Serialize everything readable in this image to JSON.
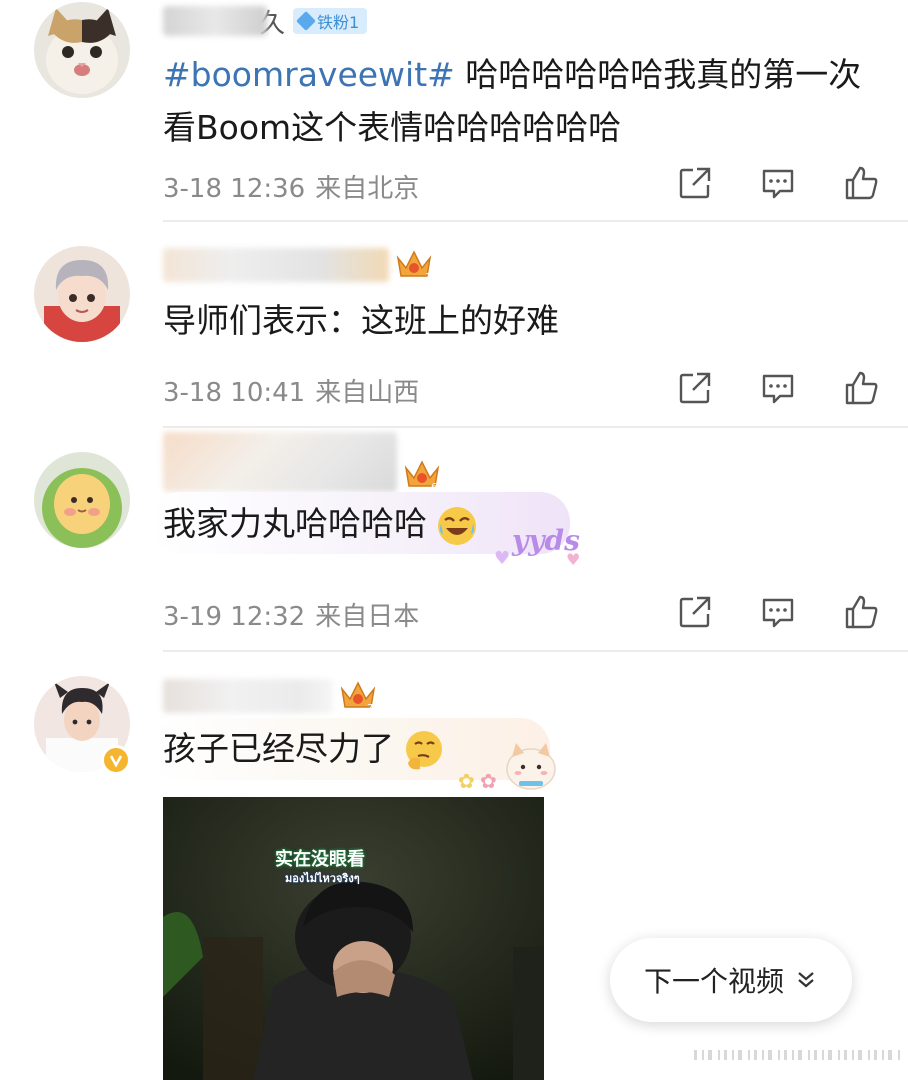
{
  "comments": [
    {
      "id": "c1",
      "username_masked": "久",
      "fan_badge": "铁粉1",
      "topic": "#boomraveewit#",
      "text_line1": " 哈哈哈哈哈哈我真的第一次",
      "text_line2": "看Boom这个表情哈哈哈哈哈哈",
      "time": "3-18 12:36",
      "location": "来自北京"
    },
    {
      "id": "c2",
      "crown_level": "1",
      "text": "导师们表示：这班上的好难",
      "time": "3-18 10:41",
      "location": "来自山西"
    },
    {
      "id": "c3",
      "crown_level": "6",
      "text": "我家力丸哈哈哈哈",
      "sticker": "yyds",
      "time": "3-19 12:32",
      "location": "来自日本"
    },
    {
      "id": "c4",
      "crown_level": "7",
      "text": "孩子已经尽力了",
      "image_caption_cn": "实在没眼看",
      "image_caption_th": "มองไม่ไหวจริงๆ"
    }
  ],
  "next_video_label": "下一个视频",
  "colors": {
    "topic_link": "#3c74b4",
    "meta_text": "#8a8a8a",
    "fan_badge_bg": "#d9ecfb"
  },
  "icons": [
    "share-icon",
    "comment-icon",
    "like-icon",
    "chevron-down-icon"
  ]
}
